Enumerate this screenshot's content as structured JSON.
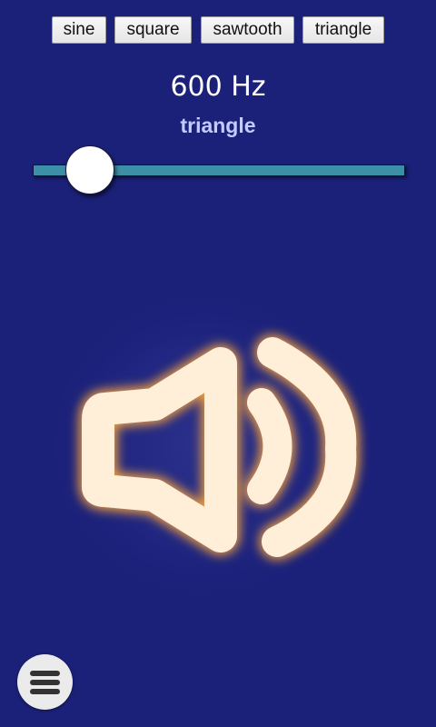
{
  "waveforms": [
    {
      "label": "sine"
    },
    {
      "label": "square"
    },
    {
      "label": "sawtooth"
    },
    {
      "label": "triangle"
    }
  ],
  "frequency": {
    "display": "600 Hz"
  },
  "waveform": {
    "selected": "triangle"
  },
  "slider": {
    "value_fraction": 0.07
  },
  "speaker": {
    "icon": "speaker-volume-icon",
    "glow_color": "#ffefd9"
  },
  "menu": {
    "icon": "hamburger-icon"
  },
  "colors": {
    "background": "#1b2179",
    "slider_track": "#3d8ea7",
    "label_accent": "#c4cbff"
  }
}
